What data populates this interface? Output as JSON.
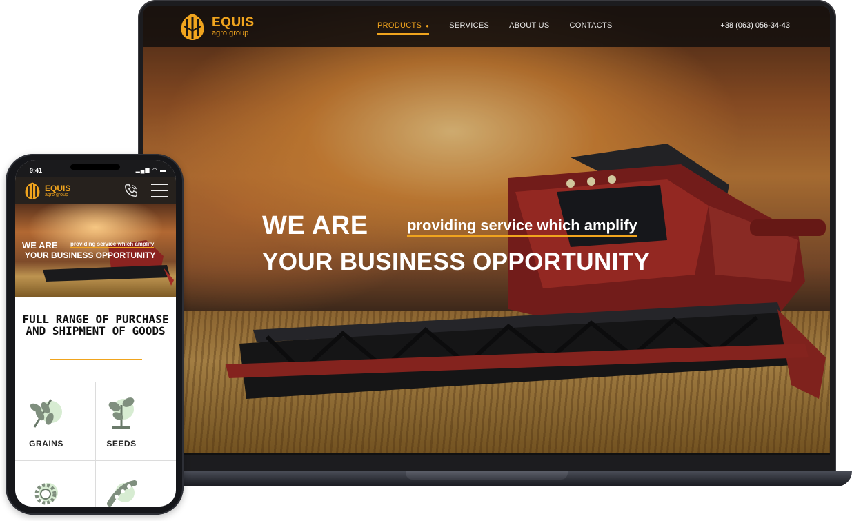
{
  "laptop": {
    "brand": {
      "name": "EQUIS",
      "tagline": "agro group"
    },
    "nav": [
      {
        "label": "PRODUCTS",
        "active": true,
        "has_dropdown": true
      },
      {
        "label": "SERVICES",
        "active": false
      },
      {
        "label": "ABOUT US",
        "active": false
      },
      {
        "label": "CONTACTS",
        "active": false
      }
    ],
    "phone": "+38 (063) 056-34-43",
    "hero": {
      "line1": "WE ARE",
      "line1_sub": "providing service which amplify",
      "line2": "YOUR BUSINESS OPPORTUNITY"
    }
  },
  "mobile": {
    "status": {
      "time": "9:41",
      "indicators": "▂▄▆ ◠ ▬"
    },
    "brand": {
      "name": "EQUIS",
      "tagline": "agro group"
    },
    "hero": {
      "line1": "WE ARE",
      "line1_sub": "providing service which amplify",
      "line2": "YOUR BUSINESS OPPORTUNITY"
    },
    "section_title": "FULL RANGE OF PURCHASE AND SHIPMENT OF GOODS",
    "categories": [
      {
        "label": "GRAINS",
        "icon": "grain-icon"
      },
      {
        "label": "SEEDS",
        "icon": "seedling-icon"
      },
      {
        "label": "",
        "icon": "sunflower-icon"
      },
      {
        "label": "",
        "icon": "pea-pod-icon"
      }
    ]
  },
  "colors": {
    "accent": "#f0a41e",
    "header_bg": "#1b1612",
    "text_light": "#ffffff"
  }
}
